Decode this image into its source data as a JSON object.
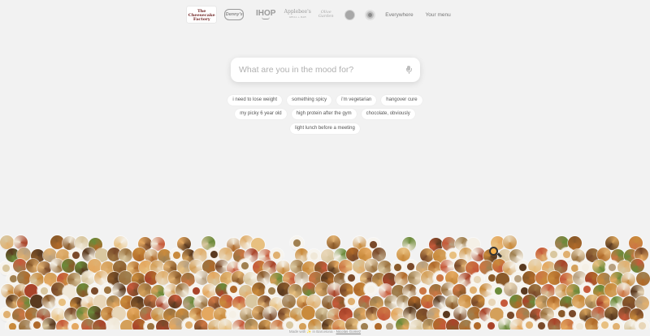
{
  "nav": {
    "brands": [
      {
        "name": "cheesecake-factory-logo",
        "text": "The Cheesecake Factory"
      },
      {
        "name": "dennys-logo",
        "text": "Denny's"
      },
      {
        "name": "ihop-logo",
        "text": "IHOP"
      },
      {
        "name": "applebees-logo",
        "text": "Applebee's",
        "sub": "GRILL + BAR"
      },
      {
        "name": "olive-garden-logo",
        "text": "Olive Garden"
      }
    ],
    "everywhere_label": "Everywhere",
    "your_menu_label": "Your menu"
  },
  "search": {
    "placeholder": "What are you in the mood for?",
    "value": ""
  },
  "suggestions": {
    "row1": [
      "i need to lose weight",
      "something spicy",
      "i'm vegetarian",
      "hangover cure"
    ],
    "row2": [
      "my picky 6 year old",
      "high protein after the gym",
      "chocolate, obviously"
    ],
    "row3": [
      "light lunch before a meeting"
    ]
  },
  "footer": {
    "text": "Made with ✨ in Barcelona ·",
    "author": "Nicolas Gomez"
  },
  "colors": {
    "background": "#f2f2f2",
    "food_palette": [
      "#c98a3c",
      "#b06a2a",
      "#e0b070",
      "#8a5a2a",
      "#d9c7a0",
      "#a9442a",
      "#e8d6b8",
      "#6b8a3a",
      "#f0e8d8",
      "#c65a3a",
      "#9c7340",
      "#d4a05a",
      "#7a4a2a",
      "#e8c080",
      "#b8a080",
      "#f5f0e6",
      "#a08050",
      "#cc7744",
      "#5a3a20",
      "#e4a860"
    ]
  }
}
